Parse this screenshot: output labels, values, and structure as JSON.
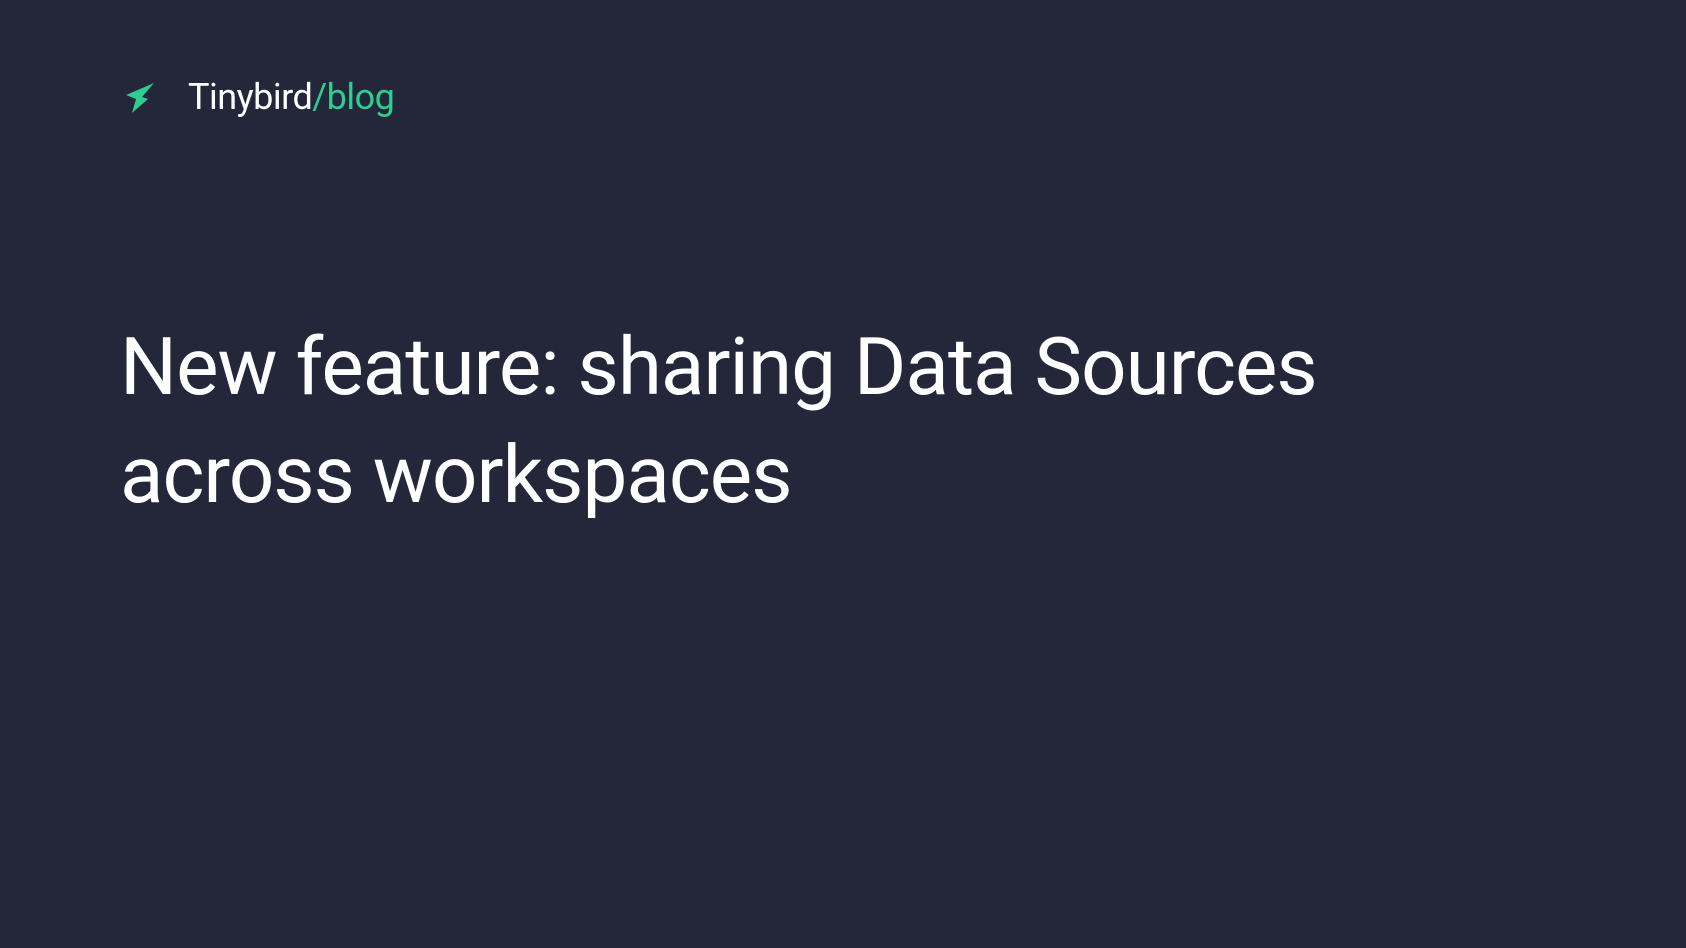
{
  "header": {
    "brand_main": "Tinybird",
    "brand_separator": "/",
    "brand_section": "blog"
  },
  "content": {
    "title": "New feature: sharing Data Sources across workspaces"
  },
  "colors": {
    "background": "#232739",
    "text": "#ffffff",
    "accent": "#2fcd8f"
  }
}
